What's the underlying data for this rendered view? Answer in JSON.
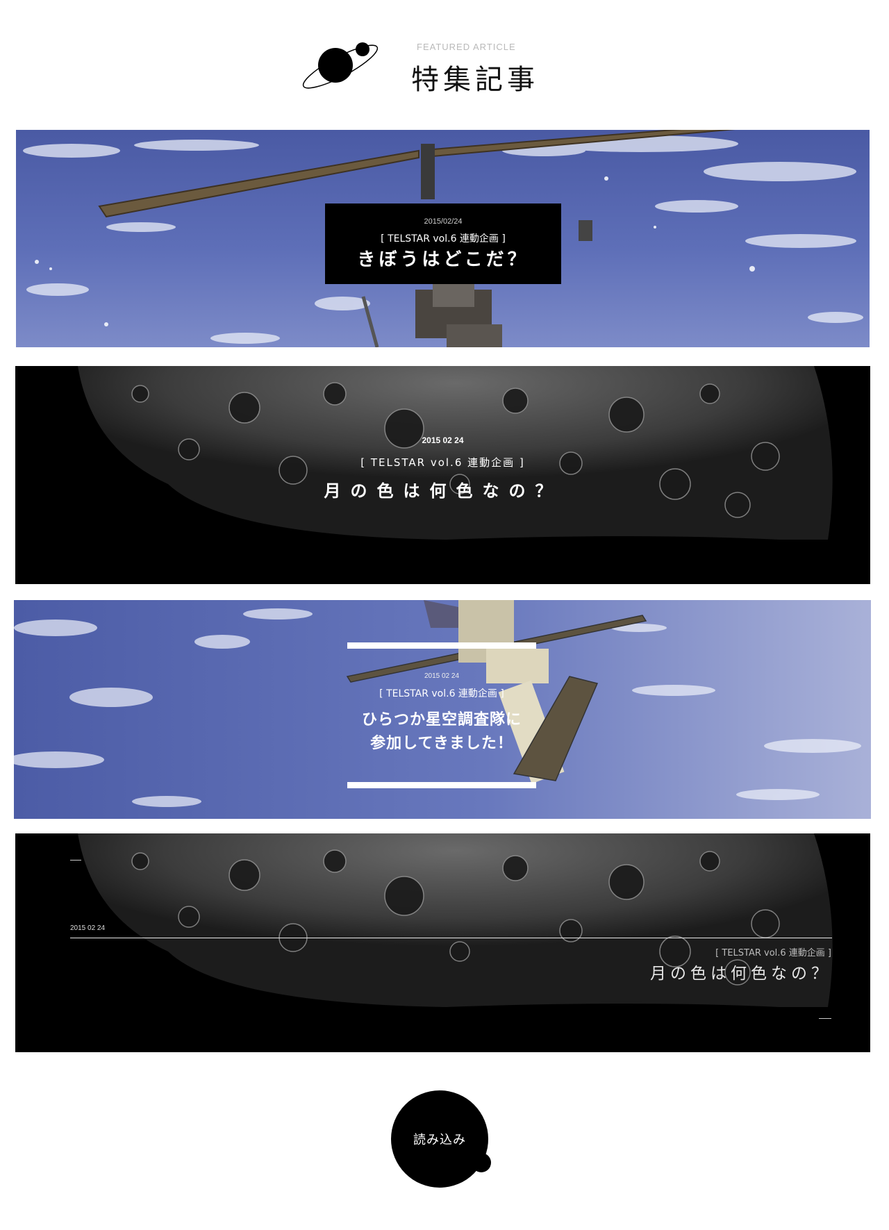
{
  "header": {
    "kicker": "FEATURED ARTICLE",
    "title": "特集記事"
  },
  "articles": [
    {
      "date": "2015/02/24",
      "series": "[ TELSTAR vol.6 連動企画 ]",
      "title": "きぼうはどこだ？",
      "image": "space-station-over-earth"
    },
    {
      "date": "2015 02 24",
      "series": "[ TELSTAR vol.6 連動企画 ]",
      "title": "月の色は何色なの？",
      "image": "moon-surface"
    },
    {
      "date": "2015 02 24",
      "series": "[ TELSTAR vol.6 連動企画 ]",
      "title_line1": "ひらつか星空調査隊に",
      "title_line2": "参加してきました！",
      "image": "space-station-over-earth"
    },
    {
      "date": "2015 02 24",
      "series": "[ TELSTAR vol.6 連動企画 ]",
      "title": "月の色は何色なの？",
      "image": "moon-surface"
    }
  ],
  "load_more": {
    "label": "読み込み"
  },
  "colors": {
    "background": "#ffffff",
    "ink": "#000000",
    "earth_blue": "#5b6cb0",
    "kicker_gray": "#b9b9b9"
  },
  "icons": {
    "logo": "planet-logo-icon"
  }
}
